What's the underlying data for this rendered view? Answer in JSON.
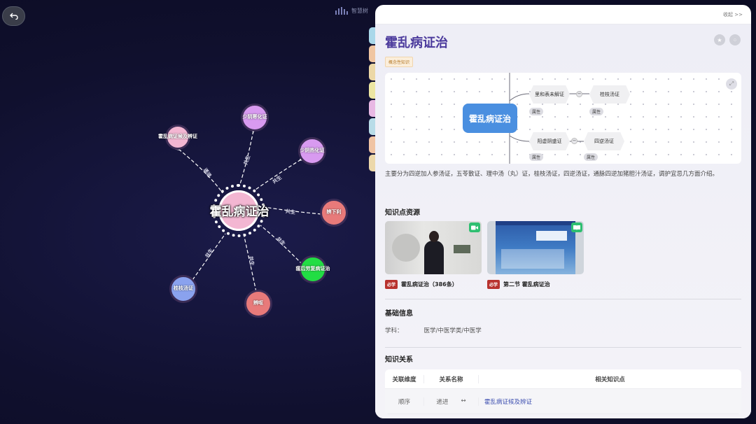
{
  "brand": {
    "name": "智慧树"
  },
  "graph": {
    "center": "霍乱病证治",
    "nodes": [
      {
        "id": "n1",
        "label": "霍乱病证候及辨证",
        "color": "#f3b6d2"
      },
      {
        "id": "n2",
        "label": "少阴寒化证",
        "color": "#d89af0"
      },
      {
        "id": "n3",
        "label": "少阴热化证",
        "color": "#d89af0"
      },
      {
        "id": "n4",
        "label": "辨下利",
        "color": "#e87a7a"
      },
      {
        "id": "n5",
        "label": "瘥后劳复病证治",
        "color": "#22dd44"
      },
      {
        "id": "n6",
        "label": "辨呕",
        "color": "#e87a7a"
      },
      {
        "id": "n7",
        "label": "桂枝汤证",
        "color": "#8aa2ee"
      }
    ],
    "relations": {
      "order": "递进",
      "co": "共生"
    }
  },
  "panel": {
    "collapse_label": "收起 >>",
    "title": "霍乱病证治",
    "tag": "概念性知识",
    "mindmap": {
      "root": "霍乱病证治",
      "branches": [
        {
          "node": "里和表未解证",
          "child": "桂枝汤证"
        },
        {
          "node": "阳虚阴盛证",
          "child": "四逆汤证"
        }
      ],
      "attr_label": "属性"
    },
    "description": "主要分为四逆加人参汤证，五苓散证、理中汤（丸）证，桂枝汤证，四逆汤证，通脉四逆加猪胆汁汤证，调护宜忌几方面介绍。",
    "resources_title": "知识点资源",
    "resources": [
      {
        "must": "必学",
        "title": "霍乱病证治（386条）",
        "kind": "video"
      },
      {
        "must": "必学",
        "title": "第二节 霍乱病证治",
        "kind": "book"
      }
    ],
    "basic_title": "基础信息",
    "subject_label": "学科：",
    "subject_value": "医学/中医学类/中医学",
    "relation_title": "知识关系",
    "table": {
      "headers": [
        "关联维度",
        "关系名称",
        "相关知识点"
      ],
      "rows": [
        {
          "dimension": "顺序",
          "relation": "递进",
          "arrow": "↔",
          "target": "霍乱病证候及辨证"
        }
      ]
    }
  },
  "colors": {
    "title": "#4b3a9c",
    "mindmap_root": "#4a8fe0",
    "must_badge": "#b8322e"
  }
}
